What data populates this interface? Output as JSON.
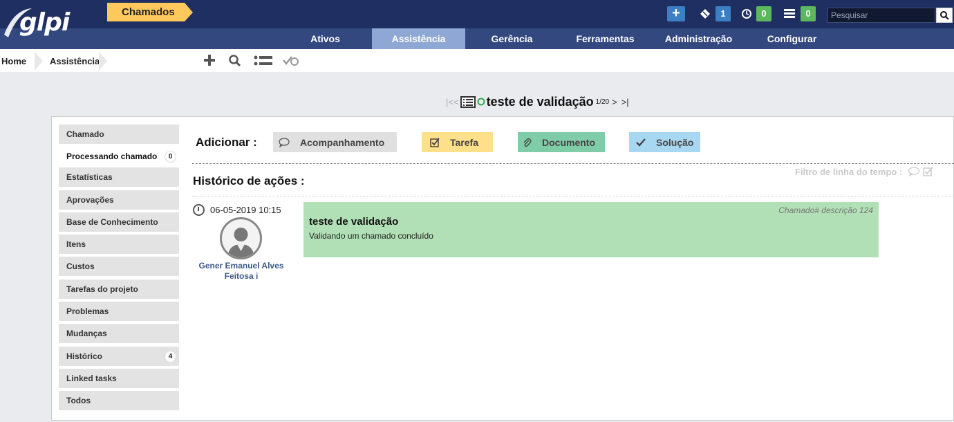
{
  "logo_text": "glpi",
  "header": {
    "add_icon": "plus-icon",
    "tickets_count": "1",
    "tickets_color": "#3c7fc2",
    "timer_count": "0",
    "timer_color": "#5cb85c",
    "list_count": "0",
    "list_color": "#5cb85c",
    "search_placeholder": "Pesquisar"
  },
  "nav": {
    "items": [
      {
        "label": "Ativos"
      },
      {
        "label": "Assistência"
      },
      {
        "label": "Gerência"
      },
      {
        "label": "Ferramentas"
      },
      {
        "label": "Administração"
      },
      {
        "label": "Configurar"
      }
    ]
  },
  "breadcrumb": {
    "home": "Home",
    "section": "Assistência",
    "current": "Chamados"
  },
  "ticket": {
    "title": "teste de validação",
    "position": "1/20",
    "status_color": "#3aa84a"
  },
  "sidebar": {
    "items": [
      {
        "label": "Chamado"
      },
      {
        "label": "Processando chamado",
        "count": "0"
      },
      {
        "label": "Estatísticas"
      },
      {
        "label": "Aprovações"
      },
      {
        "label": "Base de Conhecimento"
      },
      {
        "label": "Itens"
      },
      {
        "label": "Custos"
      },
      {
        "label": "Tarefas do projeto"
      },
      {
        "label": "Problemas"
      },
      {
        "label": "Mudanças"
      },
      {
        "label": "Histórico",
        "count": "4"
      },
      {
        "label": "Linked tasks"
      },
      {
        "label": "Todos"
      }
    ]
  },
  "actions": {
    "add_label": "Adicionar :",
    "followup": "Acompanhamento",
    "task": "Tarefa",
    "document": "Documento",
    "solution": "Solução",
    "colors": {
      "followup": "#e0e0e0",
      "task": "#ffe08a",
      "document": "#7fcca8",
      "solution": "#a8d7f2"
    }
  },
  "history": {
    "title": "Histórico de ações :",
    "filter_label": "Filtro de linha do tempo :"
  },
  "entry": {
    "date": "06-05-2019 10:15",
    "author_line1": "Gener Emanuel Alves",
    "author_line2": "Feitosa",
    "author_info": "i",
    "ref": "Chamado# descrição 124",
    "title": "teste de validação",
    "description": "Validando um chamado concluído",
    "color": "#b2e0b6"
  }
}
